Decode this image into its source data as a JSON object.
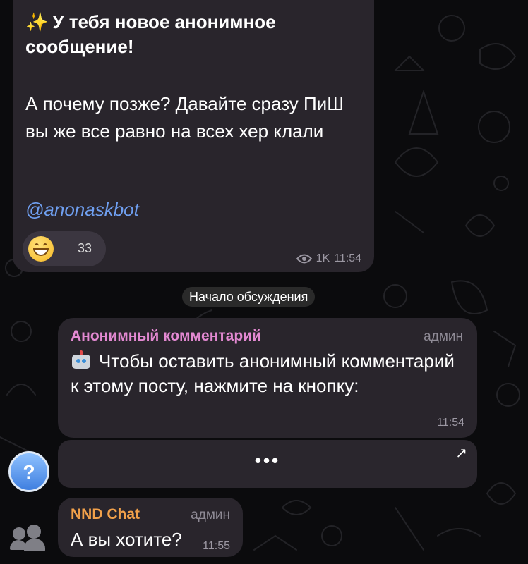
{
  "post": {
    "title": "У тебя новое анонимное сообщение!",
    "text": "А почему позже? Давайте сразу ПиШ вы же все равно на всех хер клали",
    "link": "@anonaskbot",
    "reaction_count": "33",
    "views": "1K",
    "time": "11:54"
  },
  "service_message": "Начало обсуждения",
  "comment": {
    "sender": "Анонимный комментарий",
    "role": "админ",
    "text": "Чтобы оставить анонимный комментарий к этому посту, нажмите на кнопку:",
    "time": "11:54",
    "button_label": "•••"
  },
  "reply": {
    "sender": "NND Chat",
    "role": "админ",
    "text": "А вы хотите?",
    "time": "11:55"
  },
  "icons": [
    "sparkles-icon",
    "grin-emoji-icon",
    "eye-icon",
    "robot-icon",
    "arrow-up-right-icon",
    "question-avatar-icon",
    "group-avatar-icon"
  ],
  "colors": {
    "bubble": "#29252c",
    "link": "#6f9ff0",
    "comment_sender": "#e389d2",
    "reply_sender": "#f2a14a"
  }
}
